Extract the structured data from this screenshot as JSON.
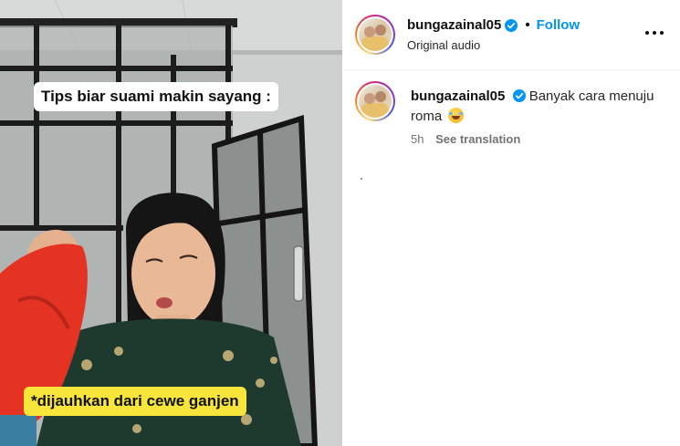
{
  "video": {
    "caption_top": "Tips biar suami makin sayang :",
    "caption_bottom": "*dijauhkan dari cewe ganjen"
  },
  "header": {
    "username": "bungazainal05",
    "follow_label": "Follow",
    "audio_label": "Original audio",
    "icons": [
      "verified-badge-icon",
      "more-options-icon"
    ]
  },
  "comment": {
    "username": "bungazainal05",
    "text": "Banyak cara menuju roma",
    "emoji": "rolling-laughing-emoji",
    "time": "5h",
    "translate_label": "See translation"
  },
  "colors": {
    "accent": "#0095f6",
    "caption_yellow": "#f7e53b",
    "muted_text": "#737373"
  }
}
